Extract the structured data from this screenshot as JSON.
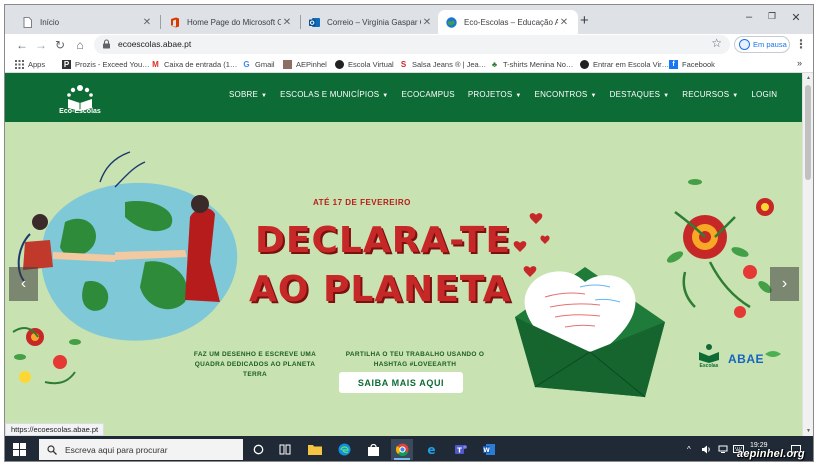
{
  "browser": {
    "tabs": [
      {
        "title": "Início",
        "favicon": "page-icon"
      },
      {
        "title": "Home Page do Microsoft Office",
        "favicon": "office-icon"
      },
      {
        "title": "Correio – Virgínia Gaspar Coito Lo…",
        "favicon": "outlook-icon"
      },
      {
        "title": "Eco-Escolas – Educação Ambient…",
        "favicon": "eco-escolas-icon",
        "active": true
      }
    ],
    "address": "ecoescolas.abae.pt",
    "profile_label": "Em pausa",
    "bookmarks": [
      {
        "label": "Apps",
        "icon": "apps-grid-icon"
      },
      {
        "label": "Prozis - Exceed You…",
        "icon": "prozis-icon"
      },
      {
        "label": "Caixa de entrada (1…",
        "icon": "gmail-icon"
      },
      {
        "label": "Gmail",
        "icon": "google-icon"
      },
      {
        "label": "AEPinhel",
        "icon": "school-icon"
      },
      {
        "label": "Escola Virtual",
        "icon": "escola-virtual-icon"
      },
      {
        "label": "Salsa Jeans ® | Jea…",
        "icon": "salsa-icon"
      },
      {
        "label": "T-shirts Menina No…",
        "icon": "tshirt-icon"
      },
      {
        "label": "Entrar em Escola Vir…",
        "icon": "circle-icon"
      },
      {
        "label": "Facebook",
        "icon": "facebook-icon"
      }
    ],
    "status_url": "https://ecoescolas.abae.pt"
  },
  "site": {
    "logo_text": "Eco-Escolas",
    "menu": [
      {
        "label": "SOBRE",
        "dropdown": true
      },
      {
        "label": "ESCOLAS E MUNICÍPIOS",
        "dropdown": true
      },
      {
        "label": "ECOCAMPUS",
        "dropdown": false
      },
      {
        "label": "PROJETOS",
        "dropdown": true
      },
      {
        "label": "ENCONTROS",
        "dropdown": true
      },
      {
        "label": "DESTAQUES",
        "dropdown": true
      },
      {
        "label": "RECURSOS",
        "dropdown": true
      },
      {
        "label": "LOGIN",
        "dropdown": false
      }
    ],
    "hero": {
      "kicker": "ATÉ 17 DE FEVEREIRO",
      "headline_1": "DECLARA-TE",
      "headline_2": "AO PLANETA",
      "desc_left": "FAZ UM DESENHO E ESCREVE UMA QUADRA DEDICADOS AO PLANETA TERRA",
      "desc_right": "PARTILHA O TEU TRABALHO USANDO O HASHTAG #LOVEEARTH",
      "cta": "SAIBA MAIS AQUI",
      "partner_1": "Eco-Escolas",
      "partner_2": "ABAE",
      "prev_arrow": "‹",
      "next_arrow": "›"
    }
  },
  "taskbar": {
    "search_placeholder": "Escreva aqui para procurar",
    "time": "19:29",
    "watermark": "aepinhel.org"
  },
  "colors": {
    "nav_green": "#0d6b35",
    "hero_bg": "#c8e2b2",
    "headline_red": "#c62828",
    "taskbar": "#1f2a36"
  }
}
